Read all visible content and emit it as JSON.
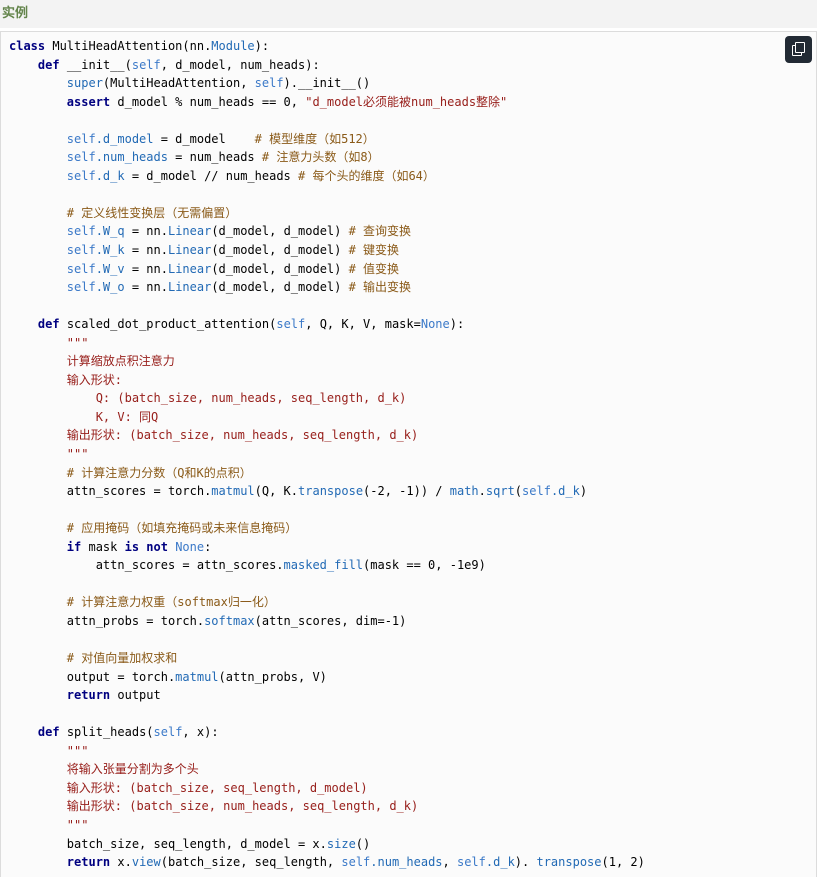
{
  "header": {
    "title": "实例"
  },
  "copy_button": {
    "icon": "copy-icon"
  },
  "colors": {
    "header_text": "#64854c",
    "keyword": "#000080",
    "builtin": "#22229a",
    "self": "#3b79c8",
    "string": "#98201c",
    "comment": "#8a5a18",
    "function": "#226ab5"
  },
  "code": {
    "lines": [
      [
        [
          "kw",
          "class"
        ],
        [
          "t",
          " MultiHeadAttention(nn."
        ],
        [
          "fn",
          "Module"
        ],
        [
          "t",
          "):"
        ]
      ],
      [
        [
          "t",
          "    "
        ],
        [
          "kw",
          "def"
        ],
        [
          "t",
          " __init__("
        ],
        [
          "self",
          "self"
        ],
        [
          "t",
          ", d_model, num_heads):"
        ]
      ],
      [
        [
          "t",
          "        "
        ],
        [
          "fn",
          "super"
        ],
        [
          "t",
          "(MultiHeadAttention, "
        ],
        [
          "self",
          "self"
        ],
        [
          "t",
          ").__init__()"
        ]
      ],
      [
        [
          "t",
          "        "
        ],
        [
          "kw",
          "assert"
        ],
        [
          "t",
          " d_model % num_heads == 0, "
        ],
        [
          "str",
          "\"d_model必须能被num_heads整除\""
        ]
      ],
      [],
      [
        [
          "t",
          "        "
        ],
        [
          "self",
          "self"
        ],
        [
          "fn",
          ".d_model"
        ],
        [
          "t",
          " = d_model    "
        ],
        [
          "com",
          "# 模型维度（如512）"
        ]
      ],
      [
        [
          "t",
          "        "
        ],
        [
          "self",
          "self"
        ],
        [
          "fn",
          ".num_heads"
        ],
        [
          "t",
          " = num_heads "
        ],
        [
          "com",
          "# 注意力头数（如8）"
        ]
      ],
      [
        [
          "t",
          "        "
        ],
        [
          "self",
          "self"
        ],
        [
          "fn",
          ".d_k"
        ],
        [
          "t",
          " = d_model // num_heads "
        ],
        [
          "com",
          "# 每个头的维度（如64）"
        ]
      ],
      [],
      [
        [
          "t",
          "        "
        ],
        [
          "com",
          "# 定义线性变换层（无需偏置）"
        ]
      ],
      [
        [
          "t",
          "        "
        ],
        [
          "self",
          "self"
        ],
        [
          "fn",
          ".W_q"
        ],
        [
          "t",
          " = nn."
        ],
        [
          "fn",
          "Linear"
        ],
        [
          "t",
          "(d_model, d_model) "
        ],
        [
          "com",
          "# 查询变换"
        ]
      ],
      [
        [
          "t",
          "        "
        ],
        [
          "self",
          "self"
        ],
        [
          "fn",
          ".W_k"
        ],
        [
          "t",
          " = nn."
        ],
        [
          "fn",
          "Linear"
        ],
        [
          "t",
          "(d_model, d_model) "
        ],
        [
          "com",
          "# 键变换"
        ]
      ],
      [
        [
          "t",
          "        "
        ],
        [
          "self",
          "self"
        ],
        [
          "fn",
          ".W_v"
        ],
        [
          "t",
          " = nn."
        ],
        [
          "fn",
          "Linear"
        ],
        [
          "t",
          "(d_model, d_model) "
        ],
        [
          "com",
          "# 值变换"
        ]
      ],
      [
        [
          "t",
          "        "
        ],
        [
          "self",
          "self"
        ],
        [
          "fn",
          ".W_o"
        ],
        [
          "t",
          " = nn."
        ],
        [
          "fn",
          "Linear"
        ],
        [
          "t",
          "(d_model, d_model) "
        ],
        [
          "com",
          "# 输出变换"
        ]
      ],
      [],
      [
        [
          "t",
          "    "
        ],
        [
          "kw",
          "def"
        ],
        [
          "t",
          " scaled_dot_product_attention("
        ],
        [
          "self",
          "self"
        ],
        [
          "t",
          ", Q, K, V, mask="
        ],
        [
          "self",
          "None"
        ],
        [
          "t",
          "):"
        ]
      ],
      [
        [
          "t",
          "        "
        ],
        [
          "str",
          "\"\"\""
        ]
      ],
      [
        [
          "t",
          "        "
        ],
        [
          "str",
          "计算缩放点积注意力"
        ]
      ],
      [
        [
          "t",
          "        "
        ],
        [
          "str",
          "输入形状:"
        ]
      ],
      [
        [
          "t",
          "            "
        ],
        [
          "str",
          "Q: (batch_size, num_heads, seq_length, d_k)"
        ]
      ],
      [
        [
          "t",
          "            "
        ],
        [
          "str",
          "K, V: 同Q"
        ]
      ],
      [
        [
          "t",
          "        "
        ],
        [
          "str",
          "输出形状: (batch_size, num_heads, seq_length, d_k)"
        ]
      ],
      [
        [
          "t",
          "        "
        ],
        [
          "str",
          "\"\"\""
        ]
      ],
      [
        [
          "t",
          "        "
        ],
        [
          "com",
          "# 计算注意力分数（Q和K的点积）"
        ]
      ],
      [
        [
          "t",
          "        attn_scores = torch."
        ],
        [
          "fn",
          "matmul"
        ],
        [
          "t",
          "(Q, K."
        ],
        [
          "fn",
          "transpose"
        ],
        [
          "t",
          "(-2, -1)) / "
        ],
        [
          "fn",
          "math"
        ],
        [
          "t",
          "."
        ],
        [
          "fn",
          "sqrt"
        ],
        [
          "t",
          "("
        ],
        [
          "self",
          "self"
        ],
        [
          "fn",
          ".d_k"
        ],
        [
          "t",
          ")"
        ]
      ],
      [],
      [
        [
          "t",
          "        "
        ],
        [
          "com",
          "# 应用掩码（如填充掩码或未来信息掩码）"
        ]
      ],
      [
        [
          "t",
          "        "
        ],
        [
          "kw",
          "if"
        ],
        [
          "t",
          " mask "
        ],
        [
          "kw",
          "is not"
        ],
        [
          "t",
          " "
        ],
        [
          "self",
          "None"
        ],
        [
          "t",
          ":"
        ]
      ],
      [
        [
          "t",
          "            attn_scores = attn_scores."
        ],
        [
          "fn",
          "masked_fill"
        ],
        [
          "t",
          "(mask == 0, -1e9)"
        ]
      ],
      [],
      [
        [
          "t",
          "        "
        ],
        [
          "com",
          "# 计算注意力权重（softmax归一化）"
        ]
      ],
      [
        [
          "t",
          "        attn_probs = torch."
        ],
        [
          "fn",
          "softmax"
        ],
        [
          "t",
          "(attn_scores, dim=-1)"
        ]
      ],
      [],
      [
        [
          "t",
          "        "
        ],
        [
          "com",
          "# 对值向量加权求和"
        ]
      ],
      [
        [
          "t",
          "        output = torch."
        ],
        [
          "fn",
          "matmul"
        ],
        [
          "t",
          "(attn_probs, V)"
        ]
      ],
      [
        [
          "t",
          "        "
        ],
        [
          "kw",
          "return"
        ],
        [
          "t",
          " output"
        ]
      ],
      [],
      [
        [
          "t",
          "    "
        ],
        [
          "kw",
          "def"
        ],
        [
          "t",
          " split_heads("
        ],
        [
          "self",
          "self"
        ],
        [
          "t",
          ", x):"
        ]
      ],
      [
        [
          "t",
          "        "
        ],
        [
          "str",
          "\"\"\""
        ]
      ],
      [
        [
          "t",
          "        "
        ],
        [
          "str",
          "将输入张量分割为多个头"
        ]
      ],
      [
        [
          "t",
          "        "
        ],
        [
          "str",
          "输入形状: (batch_size, seq_length, d_model)"
        ]
      ],
      [
        [
          "t",
          "        "
        ],
        [
          "str",
          "输出形状: (batch_size, num_heads, seq_length, d_k)"
        ]
      ],
      [
        [
          "t",
          "        "
        ],
        [
          "str",
          "\"\"\""
        ]
      ],
      [
        [
          "t",
          "        batch_size, seq_length, d_model = x."
        ],
        [
          "fn",
          "size"
        ],
        [
          "t",
          "()"
        ]
      ],
      [
        [
          "t",
          "        "
        ],
        [
          "kw",
          "return"
        ],
        [
          "t",
          " x."
        ],
        [
          "fn",
          "view"
        ],
        [
          "t",
          "(batch_size, seq_length, "
        ],
        [
          "self",
          "self"
        ],
        [
          "fn",
          ".num_heads"
        ],
        [
          "t",
          ", "
        ],
        [
          "self",
          "self"
        ],
        [
          "fn",
          ".d_k"
        ],
        [
          "t",
          "). "
        ],
        [
          "fn",
          "transpose"
        ],
        [
          "t",
          "(1, 2)"
        ]
      ]
    ]
  }
}
